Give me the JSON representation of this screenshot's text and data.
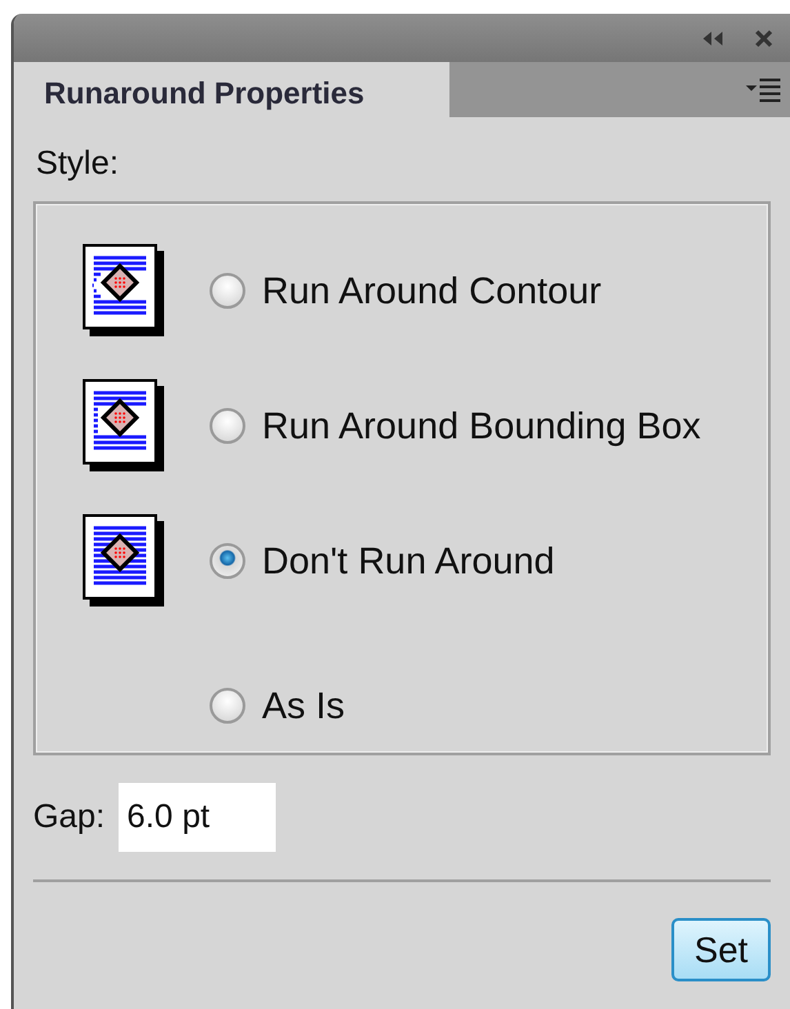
{
  "tab": {
    "label": "Runaround Properties",
    "selected": true
  },
  "style_label": "Style:",
  "options": [
    {
      "kind": "contour",
      "label": "Run Around Contour",
      "selected": false
    },
    {
      "kind": "bounding",
      "label": "Run Around Bounding Box",
      "selected": false
    },
    {
      "kind": "none",
      "label": "Don't Run Around",
      "selected": true
    },
    {
      "kind": "plain",
      "label": "As Is",
      "selected": false
    }
  ],
  "gap": {
    "label": "Gap:",
    "value": "6.0 pt"
  },
  "buttons": [
    "Set"
  ]
}
